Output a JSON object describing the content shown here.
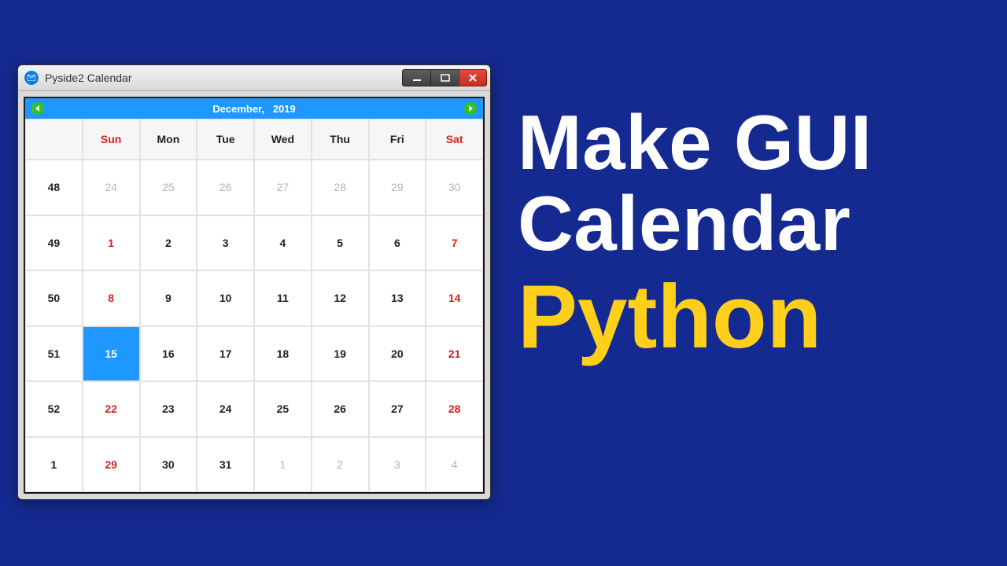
{
  "window": {
    "title": "Pyside2 Calendar",
    "icon": "mail-circle-icon"
  },
  "calendar": {
    "nav_title": "December,   2019",
    "day_headers": [
      "",
      "Sun",
      "Mon",
      "Tue",
      "Wed",
      "Thu",
      "Fri",
      "Sat"
    ],
    "weekend_columns": [
      1,
      7
    ],
    "rows": [
      {
        "week": 48,
        "days": [
          24,
          25,
          26,
          27,
          28,
          29,
          30
        ],
        "out": [
          0,
          1,
          2,
          3,
          4,
          5,
          6
        ]
      },
      {
        "week": 49,
        "days": [
          1,
          2,
          3,
          4,
          5,
          6,
          7
        ],
        "out": []
      },
      {
        "week": 50,
        "days": [
          8,
          9,
          10,
          11,
          12,
          13,
          14
        ],
        "out": []
      },
      {
        "week": 51,
        "days": [
          15,
          16,
          17,
          18,
          19,
          20,
          21
        ],
        "out": []
      },
      {
        "week": 52,
        "days": [
          22,
          23,
          24,
          25,
          26,
          27,
          28
        ],
        "out": []
      },
      {
        "week": 1,
        "days": [
          29,
          30,
          31,
          1,
          2,
          3,
          4
        ],
        "out": [
          3,
          4,
          5,
          6
        ]
      }
    ],
    "selected": {
      "row": 3,
      "col": 0
    }
  },
  "headline": {
    "line1": "Make GUI",
    "line2": "Calendar",
    "line3": "Python"
  }
}
